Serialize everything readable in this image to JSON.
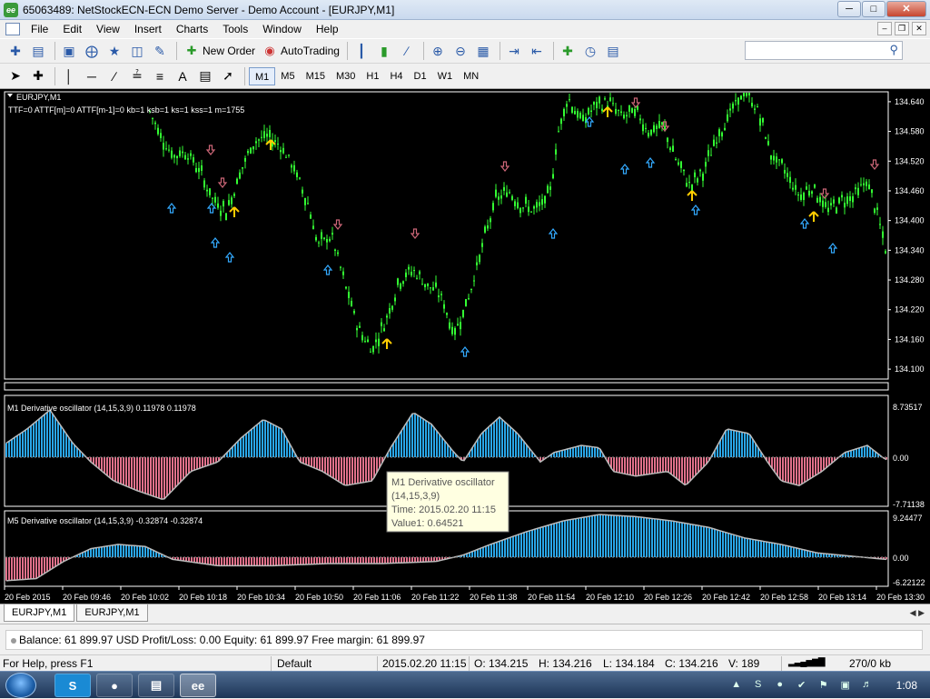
{
  "window": {
    "title": "65063489: NetStockECN-ECN Demo Server - Demo Account - [EURJPY,M1]",
    "app_icon": "ee",
    "controls": [
      "minimize-icon",
      "maximize-icon",
      "close-icon"
    ]
  },
  "menu": [
    "File",
    "Edit",
    "View",
    "Insert",
    "Charts",
    "Tools",
    "Window",
    "Help"
  ],
  "toolbar": {
    "new_order": "New Order",
    "autotrading": "AutoTrading",
    "search_placeholder": ""
  },
  "timeframes": [
    "M1",
    "M5",
    "M15",
    "M30",
    "H1",
    "H4",
    "D1",
    "W1",
    "MN"
  ],
  "active_timeframe": "M1",
  "chart": {
    "symbol": "EURJPY,M1",
    "params": "TTF=0 ATTF[m]=0 ATTF[m-1]=0 kb=1 ksb=1 ks=1 kss=1 m=1755",
    "price_ticks": [
      "134.640",
      "134.580",
      "134.520",
      "134.460",
      "134.400",
      "134.340",
      "134.280",
      "134.220",
      "134.160",
      "134.100"
    ],
    "price_range": [
      134.08,
      134.66
    ],
    "candle_color": "#33ff33",
    "up_arrow_color": "#33aaff",
    "down_arrow_color": "#cc6677",
    "signal_arrow_color": "#ffcc00"
  },
  "osc1": {
    "label": "M1 Derivative oscillator (14,15,3,9) 0.11978 0.11978",
    "ticks": [
      "8.73517",
      "0.00",
      "-7.71138"
    ],
    "range": [
      -7.71138,
      8.73517
    ]
  },
  "osc2": {
    "label": "M5 Derivative oscillator (14,15,3,9) -0.32874 -0.32874",
    "ticks": [
      "9.24477",
      "0.00",
      "-6.22122"
    ],
    "range": [
      -6.22122,
      9.24477
    ]
  },
  "time_axis": [
    "20 Feb 2015",
    "20 Feb 09:46",
    "20 Feb 10:02",
    "20 Feb 10:18",
    "20 Feb 10:34",
    "20 Feb 10:50",
    "20 Feb 11:06",
    "20 Feb 11:22",
    "20 Feb 11:38",
    "20 Feb 11:54",
    "20 Feb 12:10",
    "20 Feb 12:26",
    "20 Feb 12:42",
    "20 Feb 12:58",
    "20 Feb 13:14",
    "20 Feb 13:30"
  ],
  "tooltip": {
    "line1": "M1 Derivative oscillator",
    "line2": "(14,15,3,9)",
    "line3": "Time: 2015.02.20 11:15",
    "line4": "Value1: 0.64521"
  },
  "tabs": [
    "EURJPY,M1",
    "EURJPY,M1"
  ],
  "terminal": {
    "summary": "Balance: 61 899.97 USD  Profit/Loss: 0.00  Equity: 61 899.97  Free margin: 61 899.97"
  },
  "status": {
    "help": "For Help, press F1",
    "profile": "Default",
    "datetime": "2015.02.20 11:15",
    "open": "O: 134.215",
    "high": "H: 134.216",
    "low": "L: 134.184",
    "close": "C: 134.216",
    "volume": "V: 189",
    "traffic": "270/0 kb"
  },
  "taskbar": {
    "clock": "1:08"
  },
  "colors": {
    "osc_positive": "#29a6e8",
    "osc_negative": "#e0708a",
    "osc_line": "#bbbbbb"
  }
}
